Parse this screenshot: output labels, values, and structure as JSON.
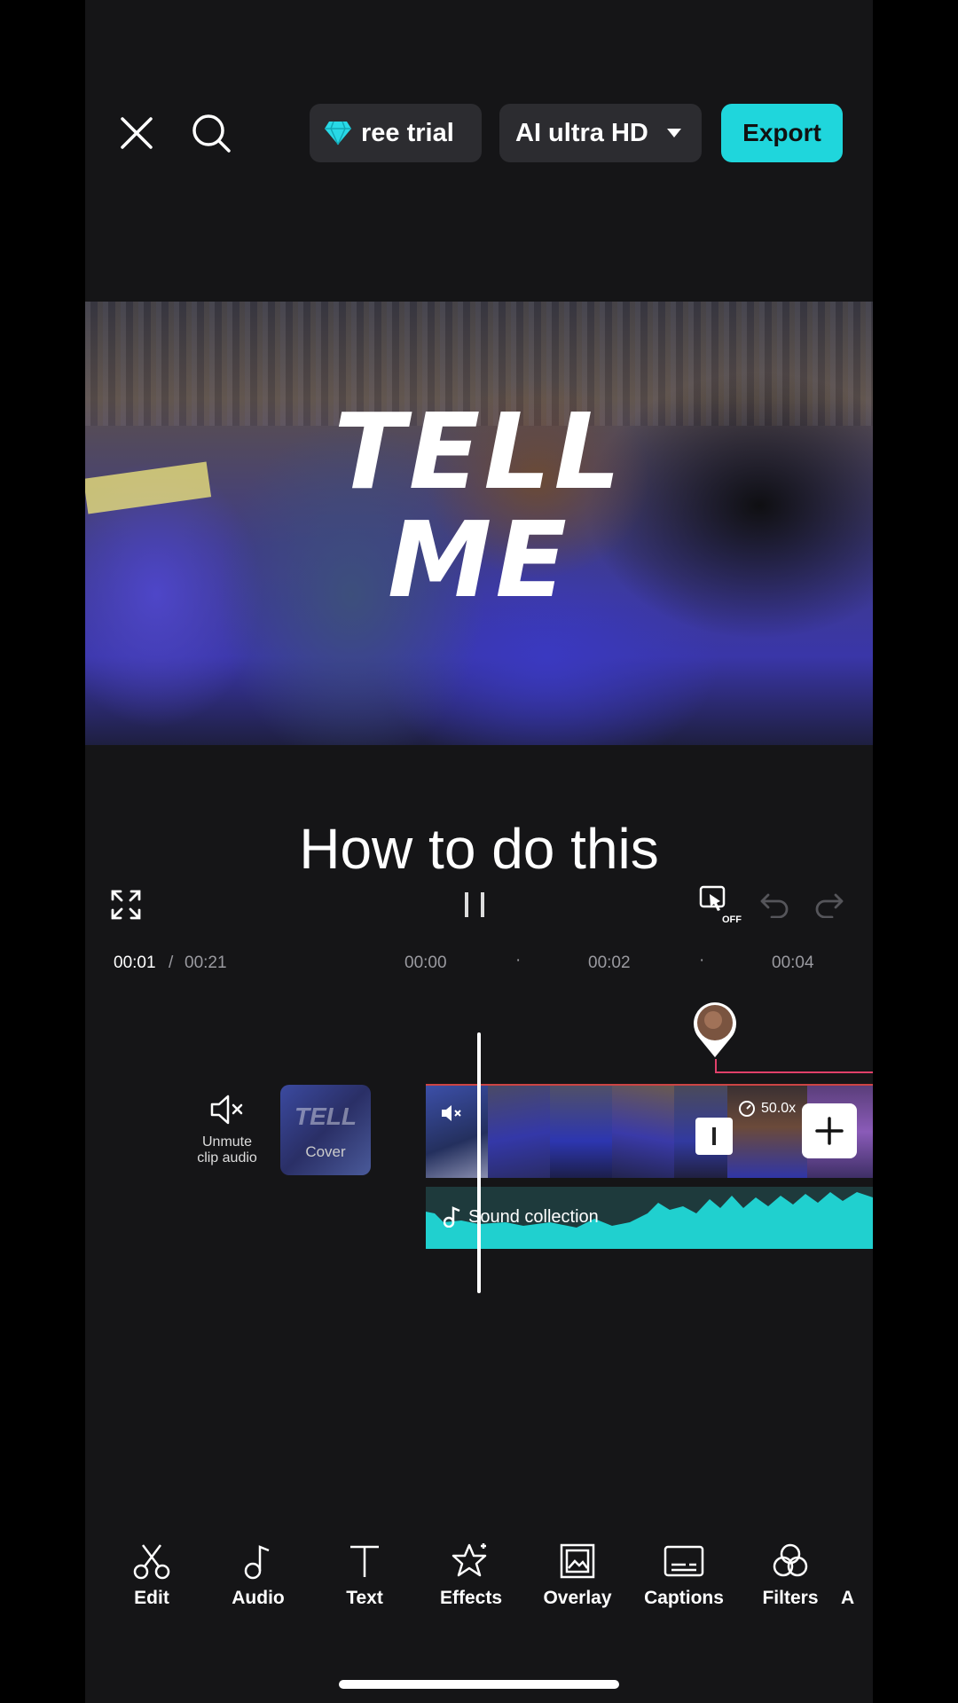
{
  "header": {
    "trial_label": "ree trial",
    "quality_label": "AI ultra HD",
    "export_label": "Export"
  },
  "preview": {
    "overlay_line1": "TELL",
    "overlay_line2": "ME"
  },
  "caption_text": "How to do this",
  "player": {
    "current_time": "00:01",
    "separator": "/",
    "total_time": "00:21",
    "ruler": [
      "00:00",
      "00:02",
      "00:04"
    ],
    "sync_state": "OFF"
  },
  "timeline": {
    "unmute_label": "Unmute\nclip audio",
    "cover_label": "Cover",
    "speed_label": "50.0x",
    "audio_label": "Sound collection"
  },
  "toolbar": [
    {
      "label": "Edit",
      "icon": "scissors-icon"
    },
    {
      "label": "Audio",
      "icon": "music-note-icon"
    },
    {
      "label": "Text",
      "icon": "text-icon"
    },
    {
      "label": "Effects",
      "icon": "sparkle-star-icon"
    },
    {
      "label": "Overlay",
      "icon": "overlay-image-icon"
    },
    {
      "label": "Captions",
      "icon": "captions-icon"
    },
    {
      "label": "Filters",
      "icon": "filters-icon"
    },
    {
      "label": "A",
      "icon": ""
    }
  ],
  "colors": {
    "accent": "#1fd6dc",
    "background": "#151517"
  }
}
